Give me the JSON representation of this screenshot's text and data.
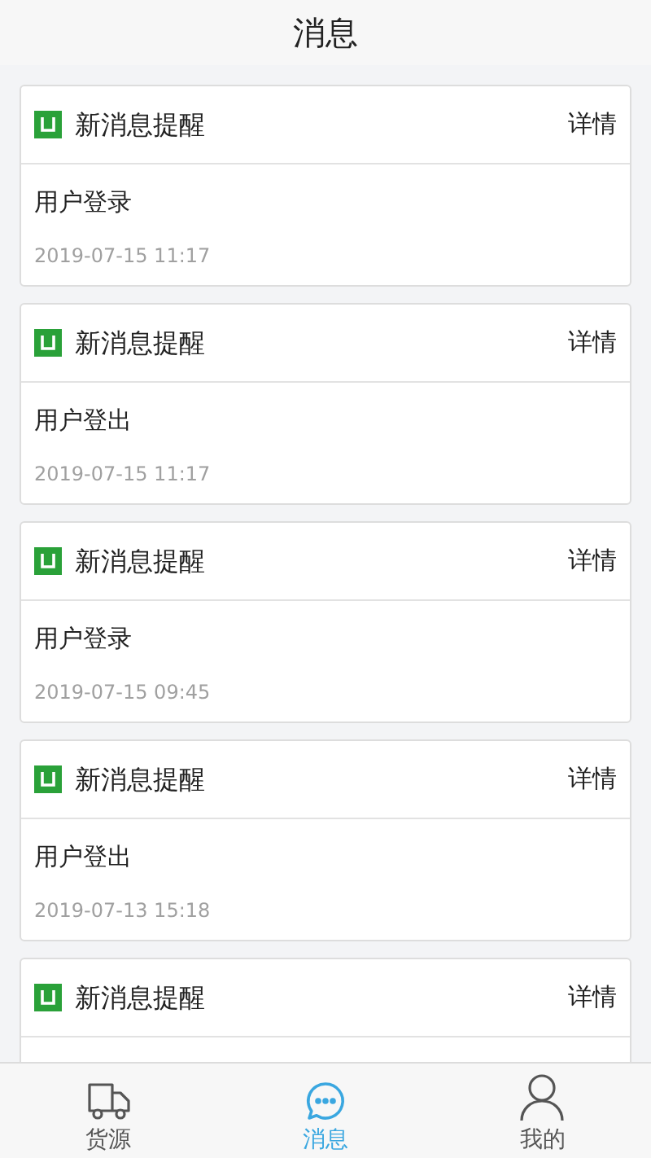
{
  "header": {
    "title": "消息"
  },
  "messages": [
    {
      "title": "新消息提醒",
      "action": "详情",
      "body": "用户登录",
      "time": "2019-07-15 11:17"
    },
    {
      "title": "新消息提醒",
      "action": "详情",
      "body": "用户登出",
      "time": "2019-07-15 11:17"
    },
    {
      "title": "新消息提醒",
      "action": "详情",
      "body": "用户登录",
      "time": "2019-07-15 09:45"
    },
    {
      "title": "新消息提醒",
      "action": "详情",
      "body": "用户登出",
      "time": "2019-07-13 15:18"
    },
    {
      "title": "新消息提醒",
      "action": "详情"
    }
  ],
  "tab_bar": [
    {
      "kind": "truck",
      "label": "货源",
      "selected": false
    },
    {
      "kind": "chat",
      "label": "消息",
      "selected": true
    },
    {
      "kind": "user",
      "label": "我的",
      "selected": false
    }
  ]
}
